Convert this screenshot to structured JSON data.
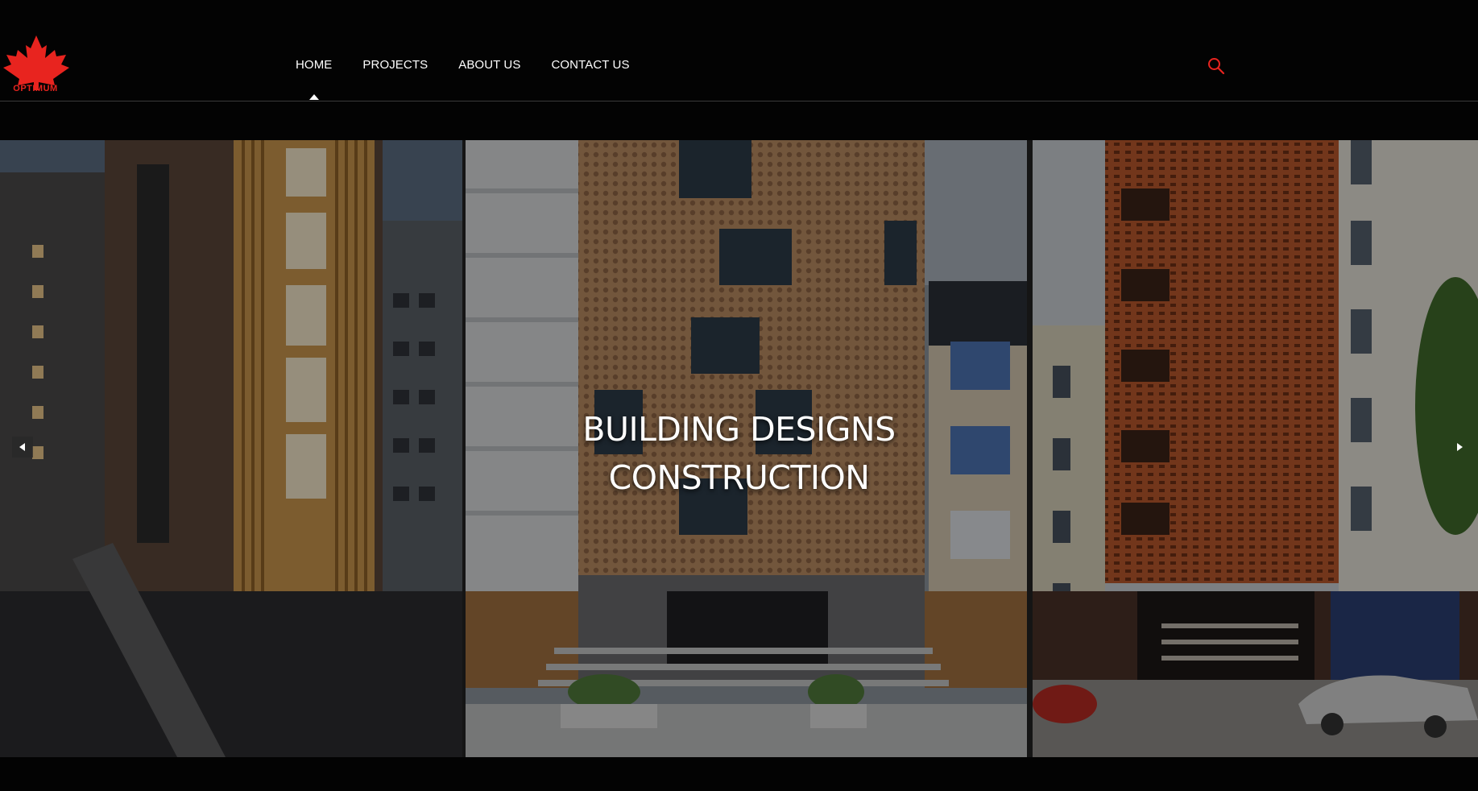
{
  "brand": {
    "logo_text": "OPTIMUM",
    "accent": "#e8241f"
  },
  "nav": {
    "items": [
      {
        "label": "HOME",
        "active": true
      },
      {
        "label": "PROJECTS"
      },
      {
        "label": "ABOUT US"
      },
      {
        "label": "CONTACT US"
      }
    ]
  },
  "search": {
    "icon": "search-icon"
  },
  "hero": {
    "caption_line1": "BUILDING DESIGNS",
    "caption_line2": "CONSTRUCTION",
    "prev_icon": "arrow-left-icon",
    "next_icon": "arrow-right-icon"
  }
}
